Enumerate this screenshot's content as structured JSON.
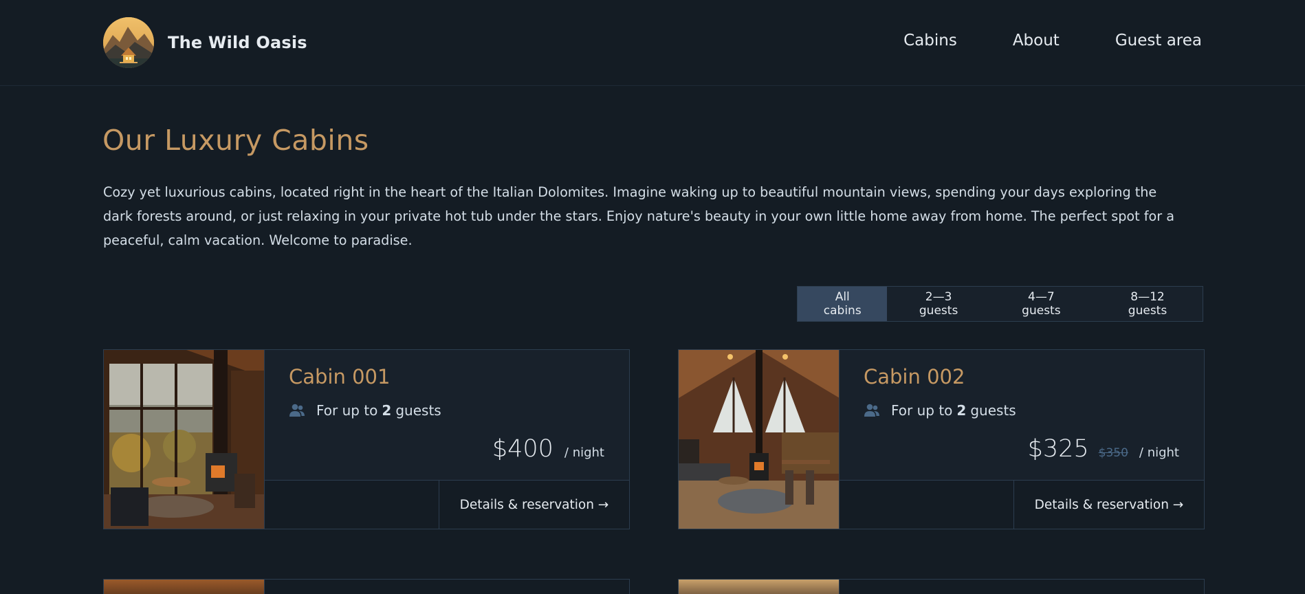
{
  "header": {
    "brand": "The Wild Oasis",
    "nav": [
      {
        "label": "Cabins"
      },
      {
        "label": "About"
      },
      {
        "label": "Guest area"
      }
    ]
  },
  "page": {
    "title": "Our Luxury Cabins",
    "intro": "Cozy yet luxurious cabins, located right in the heart of the Italian Dolomites. Imagine waking up to beautiful mountain views, spending your days exploring the dark forests around, or just relaxing in your private hot tub under the stars. Enjoy nature's beauty in your own little home away from home. The perfect spot for a peaceful, calm vacation. Welcome to paradise."
  },
  "filter": {
    "options": [
      "All cabins",
      "2—3 guests",
      "4—7 guests",
      "8—12 guests"
    ],
    "active": "All cabins"
  },
  "cabins": [
    {
      "name": "Cabin 001",
      "guests_prefix": "For up to",
      "max_guests": "2",
      "guests_suffix": "guests",
      "price": "$400",
      "old_price": "",
      "per_night": "/ night",
      "cta": "Details & reservation →"
    },
    {
      "name": "Cabin 002",
      "guests_prefix": "For up to",
      "max_guests": "2",
      "guests_suffix": "guests",
      "price": "$325",
      "old_price": "$350",
      "per_night": "/ night",
      "cta": "Details & reservation →"
    }
  ],
  "icons": {
    "guests": "users-icon",
    "logo": "mountain-cabin-logo"
  },
  "colors": {
    "background": "#141c24",
    "accent": "#c69963",
    "active_filter": "#36485f",
    "border": "#2c3d4f",
    "icon": "#4b6a89"
  }
}
